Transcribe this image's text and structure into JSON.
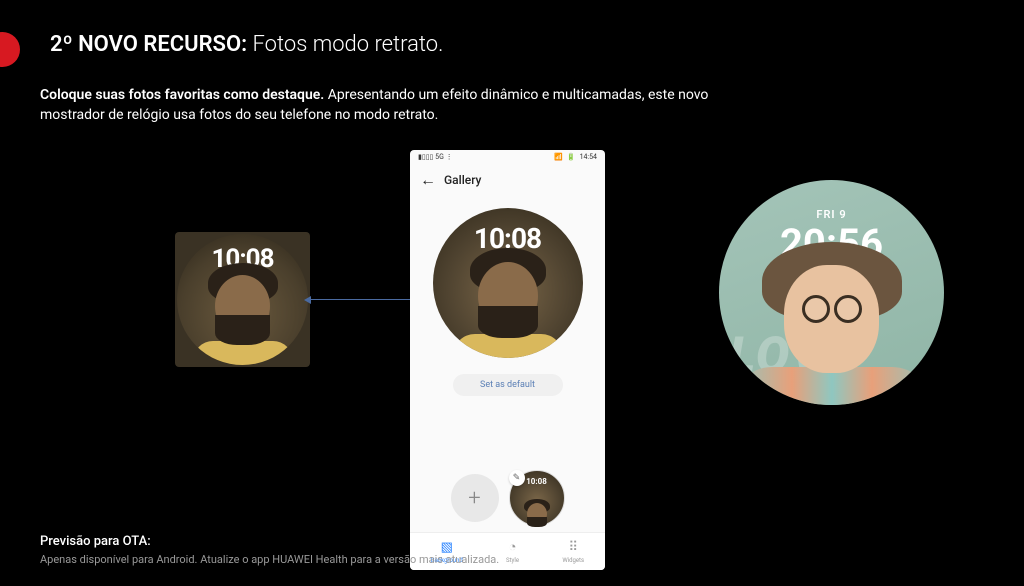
{
  "header": {
    "title_bold": "2º NOVO RECURSO:",
    "title_rest": " Fotos modo retrato."
  },
  "description": {
    "bold": "Coloque suas fotos favoritas como destaque.",
    "rest": " Apresentando um efeito dinâmico e multicamadas, este novo mostrador de relógio usa fotos do seu telefone no modo retrato."
  },
  "ota": {
    "label": "Previsão para OTA:",
    "text": "Apenas disponível para Android. Atualize o app HUAWEI Health para a versão mais atualizada."
  },
  "left_preview": {
    "time": "10:08"
  },
  "phone": {
    "status_time": "14:54",
    "back_icon": "←",
    "screen_title": "Gallery",
    "dial_time": "10:08",
    "set_default": "Set as default",
    "thumb_time": "10:08",
    "edit_icon": "✎",
    "add_icon": "+",
    "tabs": {
      "background": {
        "icon": "▧",
        "label": "Background"
      },
      "style": {
        "icon": "◔",
        "label": "Style"
      },
      "widgets": {
        "icon": "⠿",
        "label": "Widgets"
      }
    }
  },
  "watch": {
    "day": "FRI 9",
    "time": "20:56",
    "love": "LOVE"
  }
}
